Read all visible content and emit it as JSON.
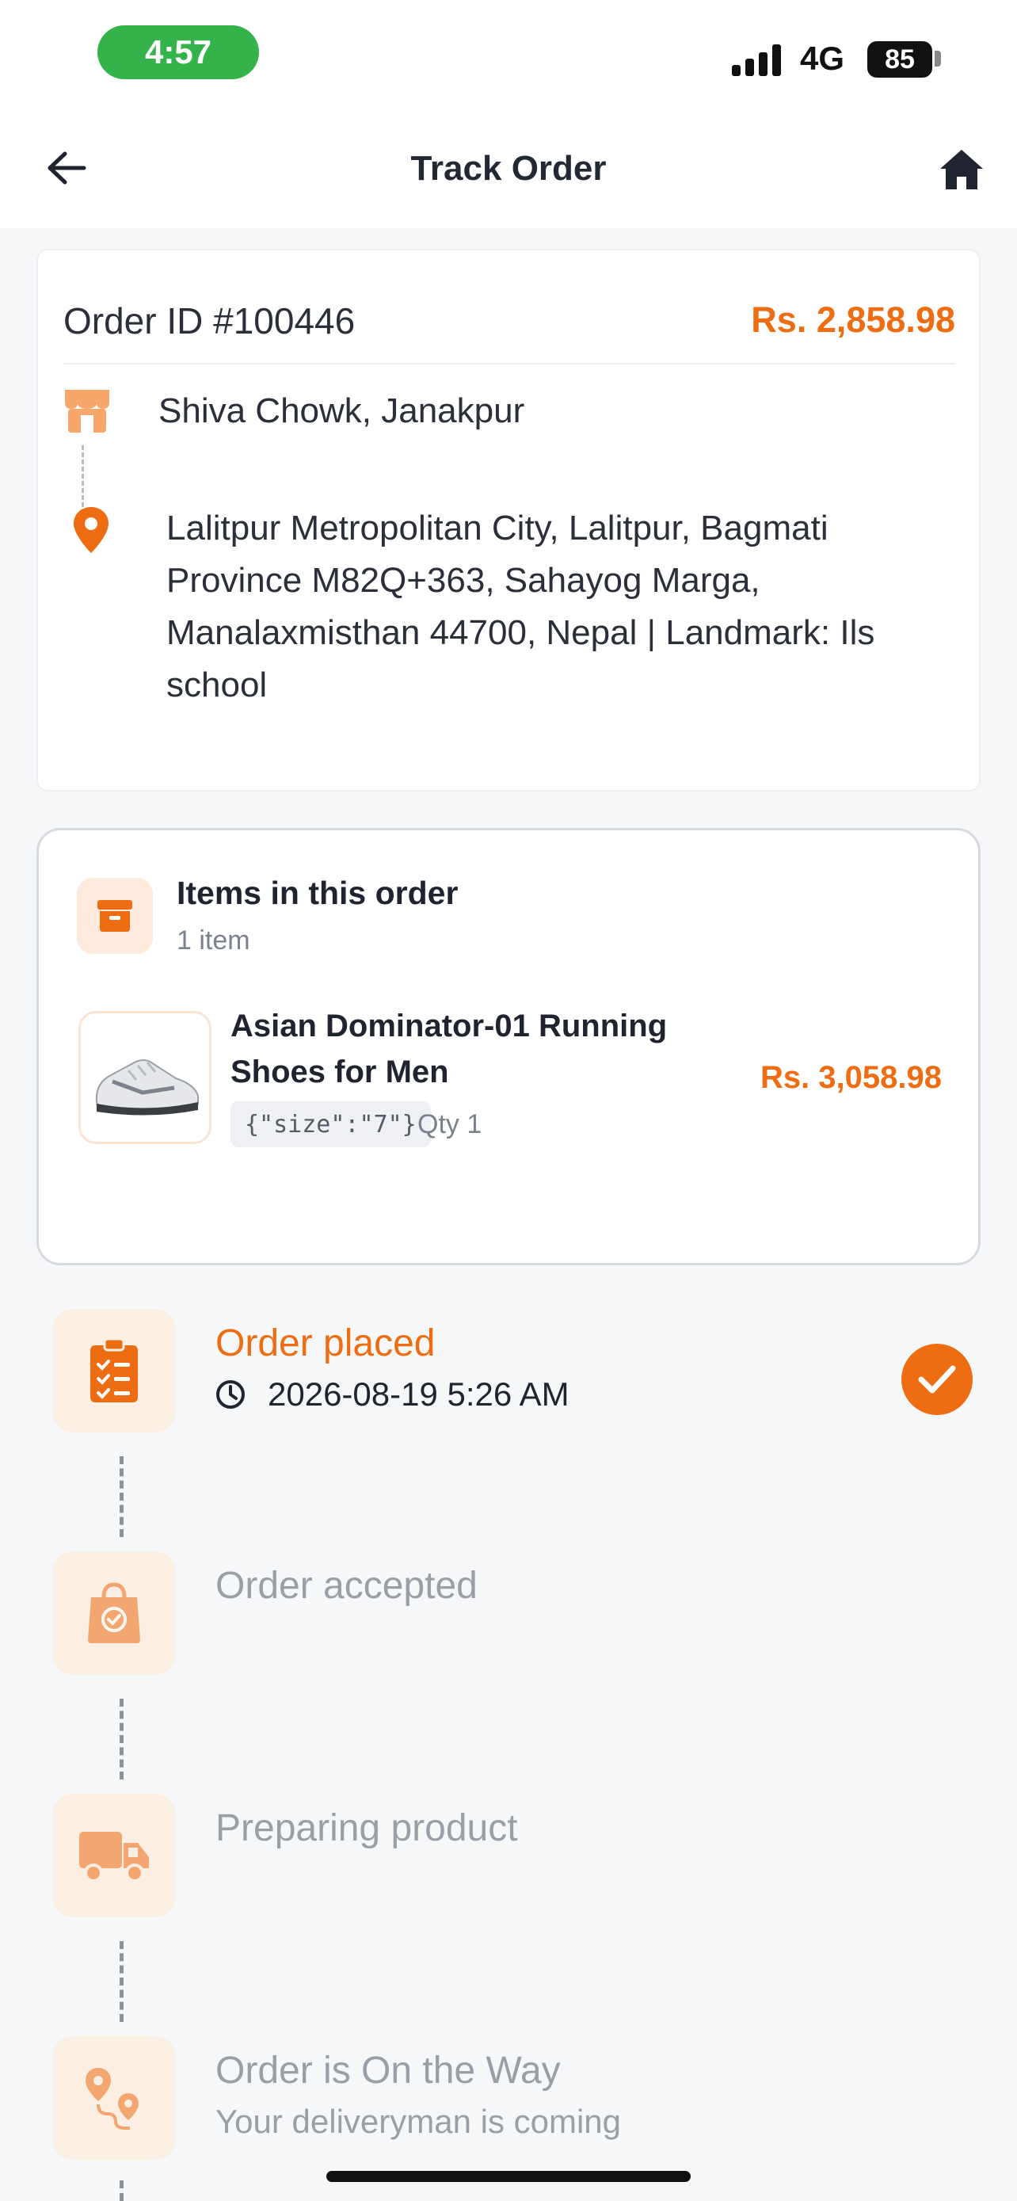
{
  "status_bar": {
    "time": "4:57",
    "network": "4G",
    "battery": "85"
  },
  "header": {
    "title": "Track Order",
    "back_icon": "arrow-left-icon",
    "home_icon": "home-icon"
  },
  "order": {
    "id_label": "Order ID #100446",
    "total": "Rs. 2,858.98",
    "store": "Shiva Chowk, Janakpur",
    "destination": "Lalitpur Metropolitan City, Lalitpur, Bagmati Province M82Q+363, Sahayog Marga, Manalaxmisthan 44700, Nepal | Landmark: Ils school"
  },
  "items": {
    "title": "Items in this order",
    "count": "1 item",
    "products": [
      {
        "name": "Asian Dominator-01 Running Shoes for Men",
        "variant": "{\"size\":\"7\"}",
        "qty": "Qty 1",
        "price": "Rs. 3,058.98"
      }
    ]
  },
  "timeline": [
    {
      "title": "Order placed",
      "time": "2026-08-19 5:26 AM",
      "done": true,
      "icon": "clipboard-check-icon"
    },
    {
      "title": "Order accepted",
      "done": false,
      "icon": "shopping-bag-icon"
    },
    {
      "title": "Preparing product",
      "done": false,
      "icon": "delivery-truck-icon"
    },
    {
      "title": "Order is On the Way",
      "subtitle": "Your deliveryman is coming",
      "done": false,
      "icon": "route-pin-icon"
    }
  ],
  "colors": {
    "accent": "#ee6d12",
    "icon_bg": "#fbeee3",
    "status_pill": "#34b34a"
  }
}
